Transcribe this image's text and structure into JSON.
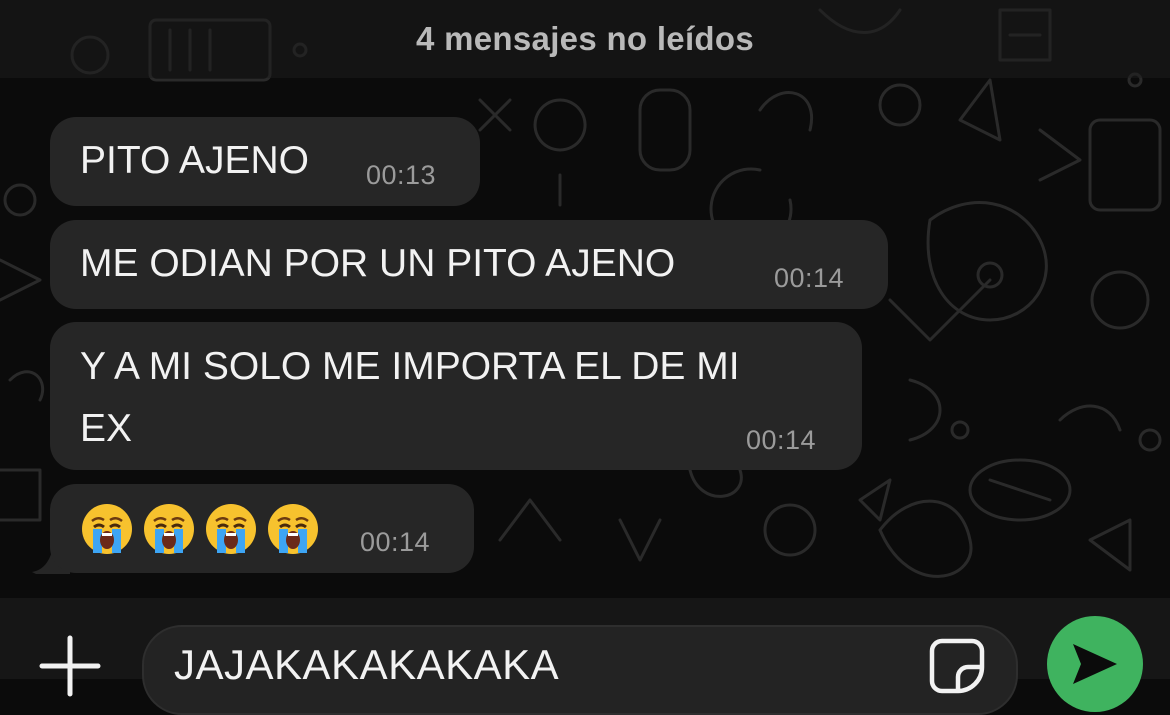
{
  "chat": {
    "unread_banner": "4 mensajes no leídos",
    "messages": [
      {
        "text": "PITO AJENO",
        "time": "00:13"
      },
      {
        "text": "ME ODIAN POR UN PITO AJENO",
        "time": "00:14"
      },
      {
        "text": "Y A MI SOLO ME IMPORTA EL DE MI\nEX",
        "time": "00:14"
      },
      {
        "emojis": [
          "loudly-crying-face",
          "loudly-crying-face",
          "loudly-crying-face",
          "loudly-crying-face"
        ],
        "time": "00:14"
      }
    ]
  },
  "composer": {
    "input_value": "JAJAKAKAKAKAKA",
    "plus_icon": "plus-icon",
    "sticker_icon": "sticker-icon",
    "send_icon": "send-icon"
  },
  "colors": {
    "background": "#0b0b0b",
    "bubble": "#262626",
    "timestamp": "#9b9b9b",
    "send_button": "#3fb35f"
  }
}
